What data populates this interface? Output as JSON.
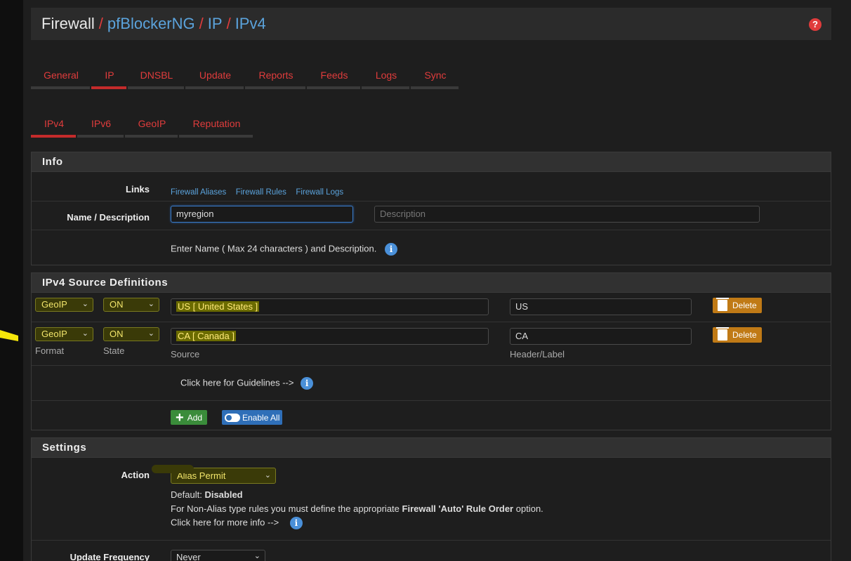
{
  "breadcrumb": {
    "home": "Firewall",
    "items": [
      "pfBlockerNG",
      "IP",
      "IPv4"
    ],
    "sep": "/"
  },
  "main_tabs": [
    {
      "label": "General",
      "active": false,
      "w": 86
    },
    {
      "label": "IP",
      "active": true,
      "w": 52
    },
    {
      "label": "DNSBL",
      "active": false,
      "w": 82
    },
    {
      "label": "Update",
      "active": false,
      "w": 85
    },
    {
      "label": "Reports",
      "active": false,
      "w": 88
    },
    {
      "label": "Feeds",
      "active": false,
      "w": 78
    },
    {
      "label": "Logs",
      "active": false,
      "w": 70
    },
    {
      "label": "Sync",
      "active": false,
      "w": 70
    }
  ],
  "sub_tabs": [
    {
      "label": "IPv4",
      "active": true,
      "w": 66
    },
    {
      "label": "IPv6",
      "active": false,
      "w": 68
    },
    {
      "label": "GeoIP",
      "active": false,
      "w": 77
    },
    {
      "label": "Reputation",
      "active": false,
      "w": 107
    }
  ],
  "info": {
    "title": "Info",
    "links_label": "Links",
    "links": [
      "Firewall Aliases",
      "Firewall Rules",
      "Firewall Logs"
    ],
    "name_label": "Name / Description",
    "name_value": "myregion",
    "desc_placeholder": "Description",
    "hint": "Enter Name ( Max 24 characters ) and Description."
  },
  "sources": {
    "title": "IPv4 Source Definitions",
    "rows": [
      {
        "format": "GeoIP",
        "state": "ON",
        "source": "US [ United States ]",
        "header": "US",
        "delete": "Delete"
      },
      {
        "format": "GeoIP",
        "state": "ON",
        "source": "CA [ Canada ]",
        "header": "CA",
        "delete": "Delete"
      }
    ],
    "col_format": "Format",
    "col_state": "State",
    "col_source": "Source",
    "col_header": "Header/Label",
    "guidelines": "Click here for Guidelines -->",
    "add_label": "Add",
    "enable_all_label": "Enable All"
  },
  "settings": {
    "title": "Settings",
    "action_label": "Action",
    "action_value": "Alias Permit",
    "default_prefix": "Default:",
    "default_value": "Disabled",
    "nonalias_prefix": "For Non-Alias type rules you must define the appropriate",
    "nonalias_bold": "Firewall 'Auto' Rule Order",
    "nonalias_suffix": "option.",
    "more_info": "Click here for more info -->",
    "update_freq_label": "Update Frequency",
    "update_freq_value": "Never"
  }
}
